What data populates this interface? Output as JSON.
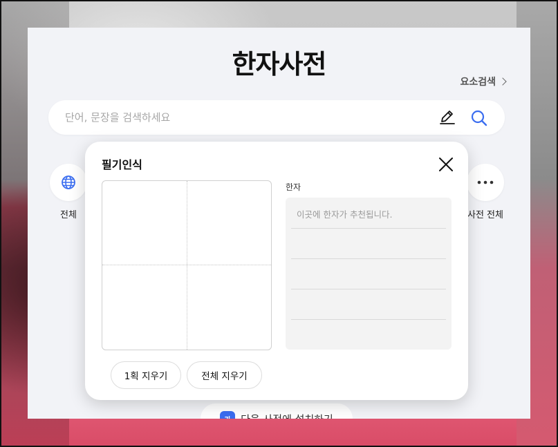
{
  "page": {
    "title": "한자사전",
    "element_search_label": "요소검색"
  },
  "search": {
    "placeholder": "단어, 문장을 검색하세요",
    "value": ""
  },
  "categories": [
    {
      "label": "전체",
      "icon": "globe-icon"
    },
    {
      "label": "사전 전체",
      "icon": "more-icon"
    }
  ],
  "install_banner": {
    "label": "다음 사전에 설치하기"
  },
  "handwriting_modal": {
    "title": "필기인식",
    "result_label": "한자",
    "result_placeholder": "이곳에 한자가 추천됩니다.",
    "clear_stroke_label": "1획 지우기",
    "clear_all_label": "전체 지우기"
  },
  "colors": {
    "accent": "#3a6df0",
    "panel_bg": "#f2f3f7",
    "result_bg": "#f3f3f3"
  }
}
